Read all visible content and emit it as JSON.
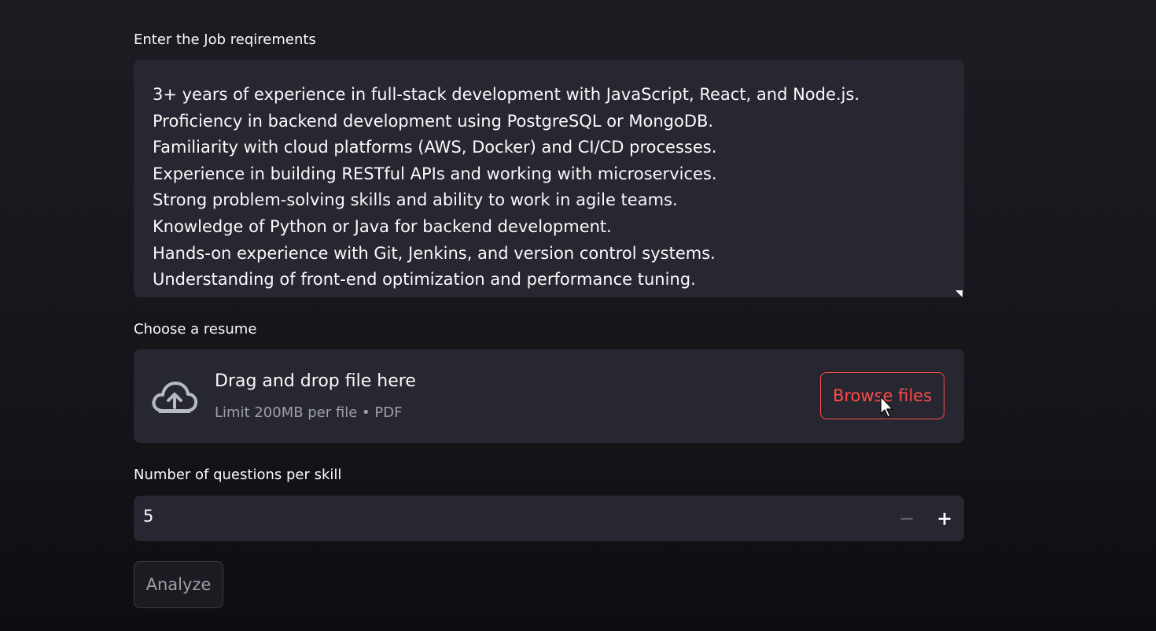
{
  "job_requirements": {
    "label": "Enter the Job reqirements",
    "lines": [
      "3+ years of experience in full-stack development with JavaScript, React, and Node.js.",
      "Proficiency in backend development using PostgreSQL or MongoDB.",
      "Familiarity with cloud platforms (AWS, Docker) and CI/CD processes.",
      "Experience in building RESTful APIs and working with microservices.",
      "Strong problem-solving skills and ability to work in agile teams.",
      "Knowledge of Python or Java for backend development.",
      "Hands-on experience with Git, Jenkins, and version control systems.",
      "Understanding of front-end optimization and performance tuning."
    ]
  },
  "resume_upload": {
    "label": "Choose a resume",
    "drop_title": "Drag and drop file here",
    "drop_hint": "Limit 200MB per file • PDF",
    "browse_label": "Browse files",
    "icon": "cloud-upload-icon"
  },
  "questions": {
    "label": "Number of questions per skill",
    "value": "5",
    "decrement_label": "−",
    "increment_label": "+"
  },
  "analyze_button": {
    "label": "Analyze"
  },
  "colors": {
    "background": "#121418",
    "widget": "#262730",
    "accent": "#ff4b4b",
    "text": "#fafafa",
    "muted": "#9ea0a8"
  }
}
